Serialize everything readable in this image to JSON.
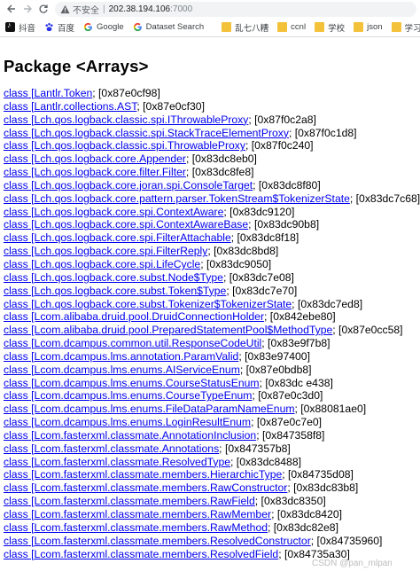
{
  "address_bar": {
    "insecure_label": "不安全",
    "separator": "|",
    "host": "202.38.194.106",
    "port": ":7000"
  },
  "bookmarks": [
    {
      "label": "抖音",
      "icon": "tiktok-icon"
    },
    {
      "label": "百度",
      "icon": "baidu-icon"
    },
    {
      "label": "Google",
      "icon": "google-icon"
    },
    {
      "label": "Dataset Search",
      "icon": "google-icon"
    },
    {
      "label": "乱七八糟",
      "icon": "folder-icon"
    },
    {
      "label": "ccnl",
      "icon": "folder-icon"
    },
    {
      "label": "学校",
      "icon": "folder-icon"
    },
    {
      "label": "json",
      "icon": "folder-icon"
    },
    {
      "label": "学习",
      "icon": "folder-icon"
    }
  ],
  "page": {
    "title": "Package <Arrays>",
    "entries": [
      {
        "link": "class [Lantlr.Token",
        "addr": "; [0x87e0cf98]"
      },
      {
        "link": "class [Lantlr.collections.AST",
        "addr": "; [0x87e0cf30]"
      },
      {
        "link": "class [Lch.qos.logback.classic.spi.IThrowableProxy",
        "addr": "; [0x87f0c2a8]"
      },
      {
        "link": "class [Lch.qos.logback.classic.spi.StackTraceElementProxy",
        "addr": "; [0x87f0c1d8]"
      },
      {
        "link": "class [Lch.qos.logback.classic.spi.ThrowableProxy",
        "addr": "; [0x87f0c240]"
      },
      {
        "link": "class [Lch.qos.logback.core.Appender",
        "addr": "; [0x83dc8eb0]"
      },
      {
        "link": "class [Lch.qos.logback.core.filter.Filter",
        "addr": "; [0x83dc8fe8]"
      },
      {
        "link": "class [Lch.qos.logback.core.joran.spi.ConsoleTarget",
        "addr": "; [0x83dc8f80]"
      },
      {
        "link": "class [Lch.qos.logback.core.pattern.parser.TokenStream$TokenizerState",
        "addr": "; [0x83dc7c68]"
      },
      {
        "link": "class [Lch.qos.logback.core.spi.ContextAware",
        "addr": "; [0x83dc9120]"
      },
      {
        "link": "class [Lch.qos.logback.core.spi.ContextAwareBase",
        "addr": "; [0x83dc90b8]"
      },
      {
        "link": "class [Lch.qos.logback.core.spi.FilterAttachable",
        "addr": "; [0x83dc8f18]"
      },
      {
        "link": "class [Lch.qos.logback.core.spi.FilterReply",
        "addr": "; [0x83dc8bd8]"
      },
      {
        "link": "class [Lch.qos.logback.core.spi.LifeCycle",
        "addr": "; [0x83dc9050]"
      },
      {
        "link": "class [Lch.qos.logback.core.subst.Node$Type",
        "addr": "; [0x83dc7e08]"
      },
      {
        "link": "class [Lch.qos.logback.core.subst.Token$Type",
        "addr": "; [0x83dc7e70]"
      },
      {
        "link": "class [Lch.qos.logback.core.subst.Tokenizer$TokenizerState",
        "addr": "; [0x83dc7ed8]"
      },
      {
        "link": "class [Lcom.alibaba.druid.pool.DruidConnectionHolder",
        "addr": "; [0x842ebe80]"
      },
      {
        "link": "class [Lcom.alibaba.druid.pool.PreparedStatementPool$MethodType",
        "addr": "; [0x87e0cc58]"
      },
      {
        "link": "class [Lcom.dcampus.common.util.ResponseCodeUtil",
        "addr": "; [0x83e9f7b8]"
      },
      {
        "link": "class [Lcom.dcampus.lms.annotation.ParamValid",
        "addr": "; [0x83e97400]"
      },
      {
        "link": "class [Lcom.dcampus.lms.enums.AIServiceEnum",
        "addr": "; [0x87e0bdb8]"
      },
      {
        "link": "class [Lcom.dcampus.lms.enums.CourseStatusEnum",
        "addr": "; [0x83dc e438]"
      },
      {
        "link": "class [Lcom.dcampus.lms.enums.CourseTypeEnum",
        "addr": "; [0x87e0c3d0]"
      },
      {
        "link": "class [Lcom.dcampus.lms.enums.FileDataParamNameEnum",
        "addr": "; [0x88081ae0]"
      },
      {
        "link": "class [Lcom.dcampus.lms.enums.LoginResultEnum",
        "addr": "; [0x87e0c7e0]"
      },
      {
        "link": "class [Lcom.fasterxml.classmate.AnnotationInclusion",
        "addr": "; [0x847358f8]"
      },
      {
        "link": "class [Lcom.fasterxml.classmate.Annotations",
        "addr": "; [0x847357b8]"
      },
      {
        "link": "class [Lcom.fasterxml.classmate.ResolvedType",
        "addr": "; [0x83dc8488]"
      },
      {
        "link": "class [Lcom.fasterxml.classmate.members.HierarchicType",
        "addr": "; [0x84735d08]"
      },
      {
        "link": "class [Lcom.fasterxml.classmate.members.RawConstructor",
        "addr": "; [0x83dc83b8]"
      },
      {
        "link": "class [Lcom.fasterxml.classmate.members.RawField",
        "addr": "; [0x83dc8350]"
      },
      {
        "link": "class [Lcom.fasterxml.classmate.members.RawMember",
        "addr": "; [0x83dc8420]"
      },
      {
        "link": "class [Lcom.fasterxml.classmate.members.RawMethod",
        "addr": "; [0x83dc82e8]"
      },
      {
        "link": "class [Lcom.fasterxml.classmate.members.ResolvedConstructor",
        "addr": "; [0x84735960]"
      },
      {
        "link": "class [Lcom.fasterxml.classmate.members.ResolvedField",
        "addr": "; [0x84735a30]"
      }
    ]
  },
  "watermark": "CSDN @pan_mlpan"
}
